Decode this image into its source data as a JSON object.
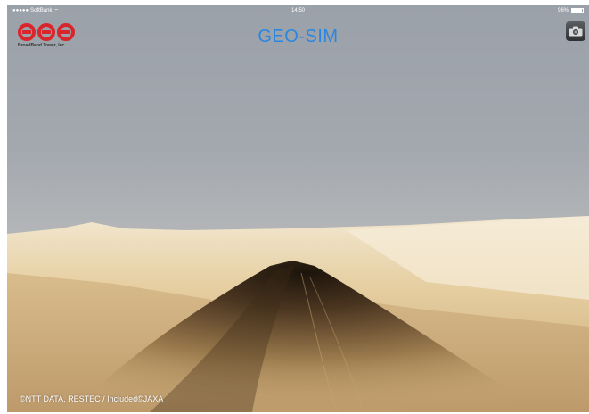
{
  "status_bar": {
    "carrier": "SoftBank",
    "time": "14:50",
    "battery": "96%"
  },
  "app": {
    "title": "GEO-SIM",
    "logo_text": "BroadBand Tower, Inc."
  },
  "icons": {
    "logo": "broadband-tower-logo",
    "camera": "camera-icon",
    "wifi": "wifi-icon",
    "battery": "battery-icon"
  },
  "credit": "©NTT DATA, RESTEC / Included©JAXA",
  "colors": {
    "title": "#2b86e0",
    "logo_red": "#d9262c",
    "sky": "#9ea3ab",
    "sand": "#d9bf8f"
  }
}
